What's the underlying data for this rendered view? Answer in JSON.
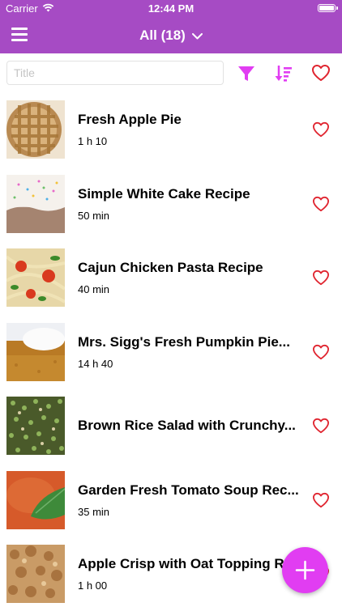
{
  "status_bar": {
    "carrier": "Carrier",
    "time": "12:44 PM"
  },
  "nav": {
    "title": "All (18)",
    "icons": {
      "menu": "hamburger-menu-icon",
      "dropdown": "chevron-down-icon"
    }
  },
  "search": {
    "placeholder": "Title",
    "value": ""
  },
  "toolbar": {
    "icons": [
      "filter-icon",
      "sort-icon",
      "heart-outline-icon"
    ]
  },
  "colors": {
    "header": "#a64bc4",
    "accent": "#e13df2",
    "heart": "#e0242f"
  },
  "recipes": [
    {
      "title": "Fresh Apple Pie",
      "time": "1 h 10"
    },
    {
      "title": "Simple White Cake Recipe",
      "time": "50 min"
    },
    {
      "title": "Cajun Chicken Pasta Recipe",
      "time": "40 min"
    },
    {
      "title": "Mrs. Sigg's Fresh Pumpkin Pie...",
      "time": "14 h 40"
    },
    {
      "title": "Brown Rice Salad with Crunchy...",
      "time": ""
    },
    {
      "title": "Garden Fresh Tomato Soup Rec...",
      "time": "35 min"
    },
    {
      "title": "Apple Crisp with Oat Topping R...",
      "time": "1 h 00"
    }
  ],
  "fab": {
    "icon": "plus-icon"
  }
}
